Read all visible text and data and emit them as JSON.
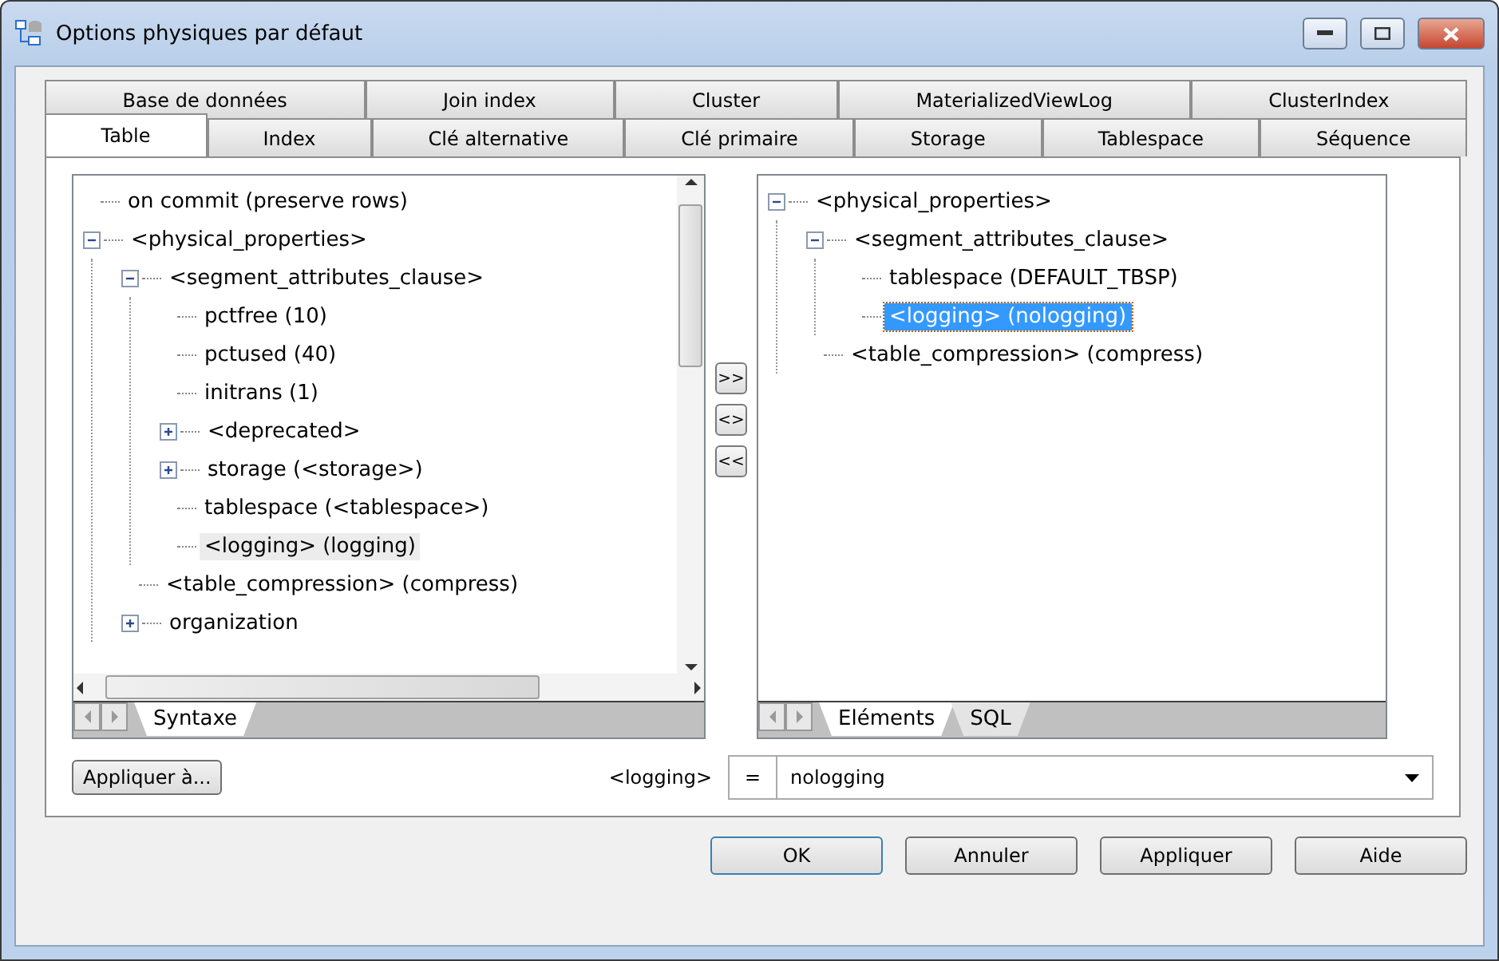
{
  "window": {
    "title": "Options physiques par défaut"
  },
  "tab_rows": [
    [
      {
        "label": "Base de données",
        "selected": false
      },
      {
        "label": "Join index",
        "selected": false
      },
      {
        "label": "Cluster",
        "selected": false
      },
      {
        "label": "MaterializedViewLog",
        "selected": false
      },
      {
        "label": "ClusterIndex",
        "selected": false
      }
    ],
    [
      {
        "label": "Table",
        "selected": true
      },
      {
        "label": "Index",
        "selected": false
      },
      {
        "label": "Clé alternative",
        "selected": false
      },
      {
        "label": "Clé primaire",
        "selected": false
      },
      {
        "label": "Storage",
        "selected": false
      },
      {
        "label": "Tablespace",
        "selected": false
      },
      {
        "label": "Séquence",
        "selected": false
      }
    ]
  ],
  "left_tree": {
    "items": [
      {
        "label": "on commit (preserve rows)",
        "selected": false
      },
      {
        "label": "<physical_properties>",
        "selected": false,
        "expanded": true,
        "children": [
          {
            "label": "<segment_attributes_clause>",
            "selected": false,
            "expanded": true,
            "children": [
              {
                "label": "pctfree (10)",
                "selected": false
              },
              {
                "label": "pctused (40)",
                "selected": false
              },
              {
                "label": "initrans (1)",
                "selected": false
              },
              {
                "label": "<deprecated>",
                "selected": false,
                "expanded": false
              },
              {
                "label": "storage (<storage>)",
                "selected": false,
                "expanded": false
              },
              {
                "label": "tablespace (<tablespace>)",
                "selected": false
              },
              {
                "label": "<logging> (logging)",
                "selected": true
              }
            ]
          },
          {
            "label": "<table_compression> (compress)",
            "selected": false
          },
          {
            "label": "organization",
            "selected": false,
            "expanded": false
          }
        ]
      }
    ],
    "tabs": [
      {
        "label": "Syntaxe",
        "selected": true
      }
    ]
  },
  "move_buttons": [
    ">>",
    "<>",
    "<<"
  ],
  "right_tree": {
    "items": [
      {
        "label": "<physical_properties>",
        "selected": false,
        "expanded": true,
        "children": [
          {
            "label": "<segment_attributes_clause>",
            "selected": false,
            "expanded": true,
            "children": [
              {
                "label": "tablespace (DEFAULT_TBSP)",
                "selected": false
              },
              {
                "label": "<logging> (nologging)",
                "selected": true
              }
            ]
          },
          {
            "label": "<table_compression> (compress)",
            "selected": false
          }
        ]
      }
    ],
    "tabs": [
      {
        "label": "Eléments",
        "selected": true
      },
      {
        "label": "SQL",
        "selected": false
      }
    ]
  },
  "apply_to_button": "Appliquer à...",
  "value_row": {
    "label": "<logging>",
    "operator": "=",
    "value": "nologging"
  },
  "buttons": [
    {
      "label": "OK",
      "default": true
    },
    {
      "label": "Annuler",
      "default": false
    },
    {
      "label": "Appliquer",
      "default": false
    },
    {
      "label": "Aide",
      "default": false
    }
  ]
}
